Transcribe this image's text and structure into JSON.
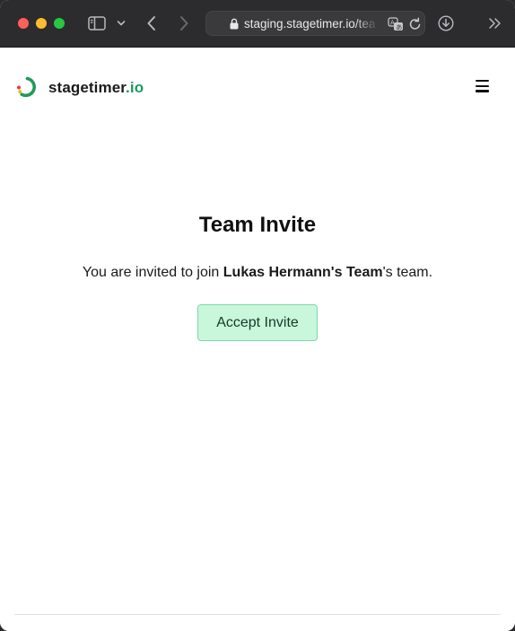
{
  "browser": {
    "url": "staging.stagetimer.io/tea",
    "colors": {
      "toolbar": "#2c2c2e",
      "urlbar": "#3a3a3c",
      "close": "#ff5f57",
      "minimize": "#febc2e",
      "zoom": "#28c840"
    },
    "icons": [
      "sidebar-icon",
      "chevron-down-icon",
      "back-arrow-icon",
      "forward-arrow-icon",
      "lock-icon",
      "translate-icon",
      "reload-icon",
      "download-icon",
      "double-chevron-icon"
    ]
  },
  "header": {
    "brand_name": "stagetimer",
    "brand_tld": ".io",
    "menu_icon": "hamburger-icon"
  },
  "invite": {
    "title": "Team Invite",
    "text_prefix": "You are invited to join ",
    "team_name": "Lukas Hermann's Team",
    "text_suffix": "'s team.",
    "accept_label": "Accept Invite"
  },
  "colors": {
    "brand_accent": "#1f9a5b",
    "button_bg": "#c8f7dc",
    "button_border": "#7fd8a5"
  }
}
